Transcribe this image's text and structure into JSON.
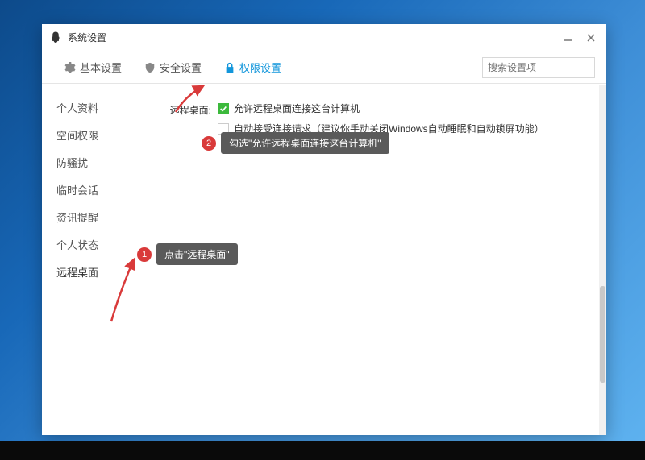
{
  "window": {
    "title": "系统设置"
  },
  "tabs": [
    {
      "label": "基本设置",
      "icon": "gear"
    },
    {
      "label": "安全设置",
      "icon": "shield"
    },
    {
      "label": "权限设置",
      "icon": "lock",
      "active": true
    }
  ],
  "search": {
    "placeholder": "搜索设置项"
  },
  "sidebar": {
    "items": [
      {
        "label": "个人资料"
      },
      {
        "label": "空间权限"
      },
      {
        "label": "防骚扰"
      },
      {
        "label": "临时会话"
      },
      {
        "label": "资讯提醒"
      },
      {
        "label": "个人状态"
      },
      {
        "label": "远程桌面",
        "selected": true
      }
    ]
  },
  "main": {
    "section_label": "远程桌面:",
    "option1": "允许远程桌面连接这台计算机",
    "option2": "自动接受连接请求（建议你手动关闭Windows自动睡眠和自动锁屏功能）"
  },
  "annotations": [
    {
      "num": "1",
      "text": "点击\"远程桌面\""
    },
    {
      "num": "2",
      "text": "勾选\"允许远程桌面连接这台计算机\""
    }
  ]
}
